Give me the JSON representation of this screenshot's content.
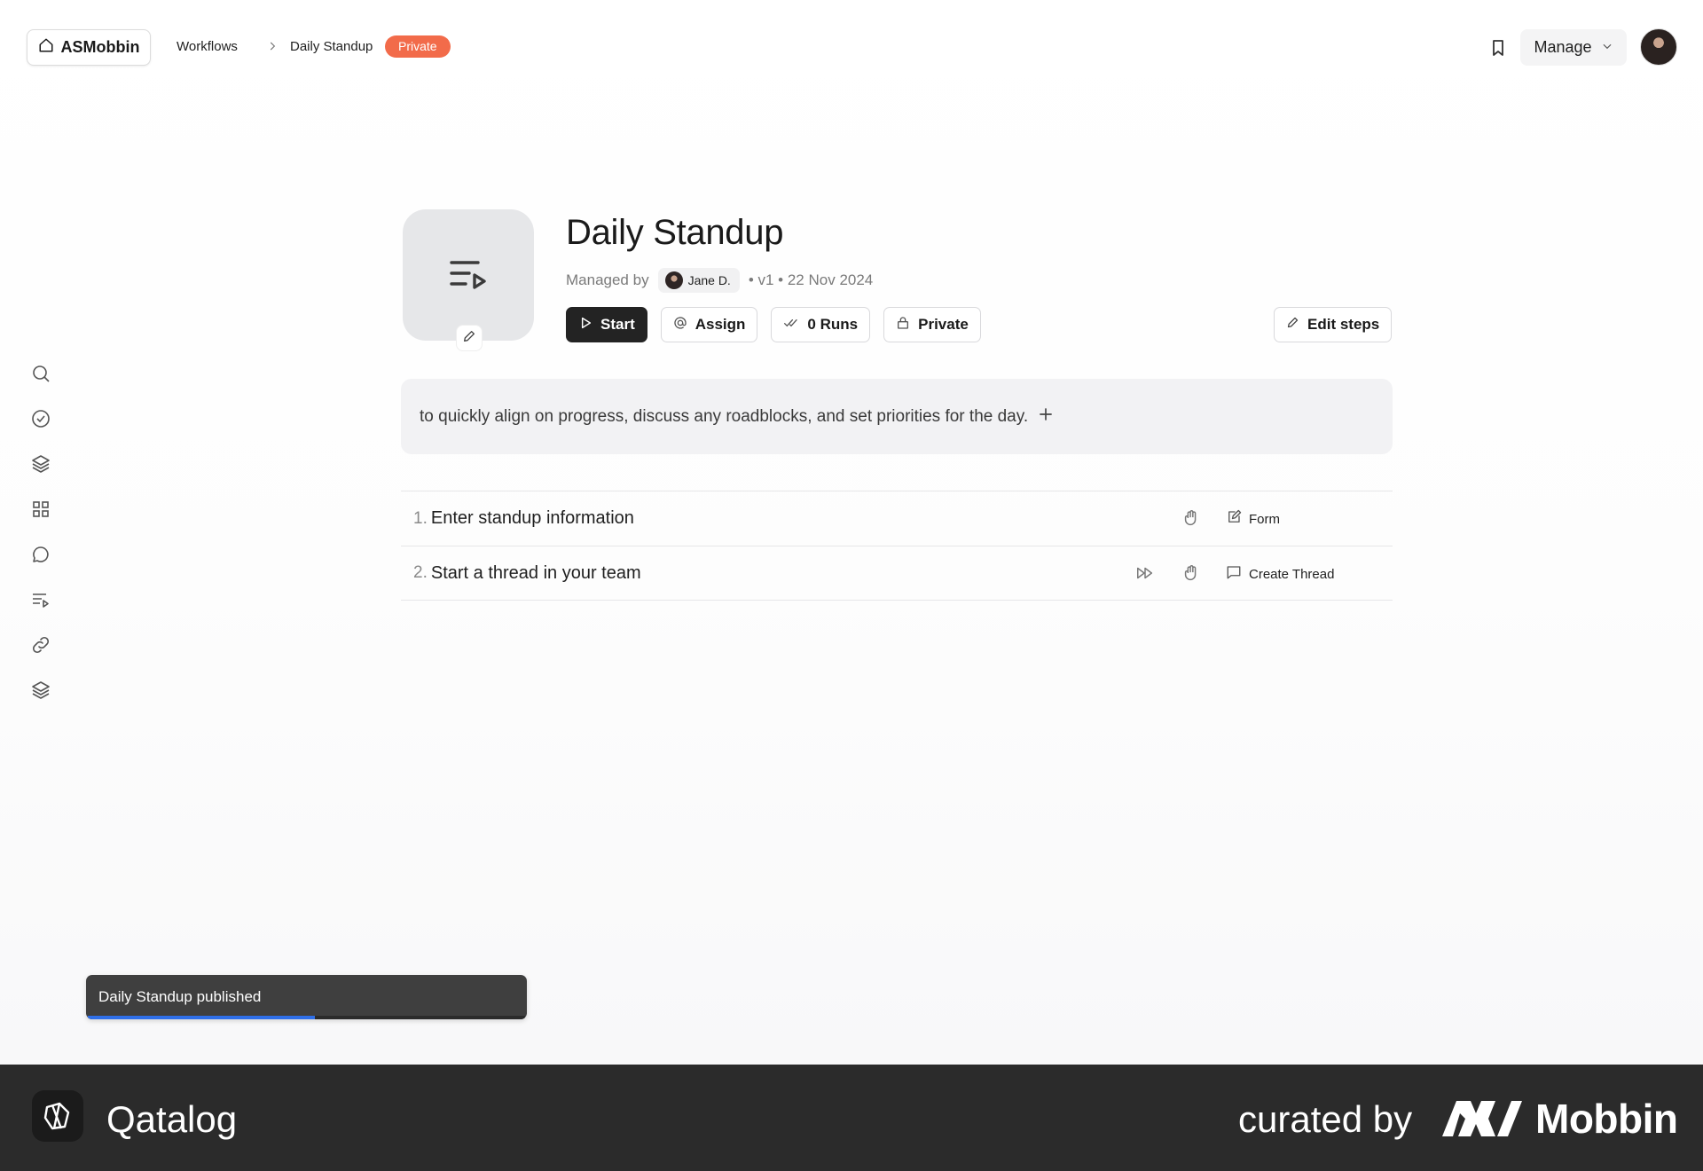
{
  "topbar": {
    "home_label": "ASMobbin",
    "breadcrumb_workflows": "Workflows",
    "breadcrumb_current": "Daily Standup",
    "visibility_badge": "Private",
    "manage_label": "Manage"
  },
  "sidebar": {
    "items": [
      {
        "icon": "search-icon"
      },
      {
        "icon": "check-circle-icon"
      },
      {
        "icon": "layers-icon"
      },
      {
        "icon": "grid-icon"
      },
      {
        "icon": "chat-icon"
      },
      {
        "icon": "workflow-list-icon"
      },
      {
        "icon": "link-icon"
      },
      {
        "icon": "stack-icon"
      }
    ]
  },
  "workflow": {
    "title": "Daily Standup",
    "managed_by_label": "Managed by",
    "manager_name": "Jane D.",
    "version_date": "• v1 • 22 Nov 2024",
    "actions": {
      "start": "Start",
      "assign": "Assign",
      "runs": "0 Runs",
      "private": "Private",
      "edit_steps": "Edit steps"
    },
    "description": "to quickly align on progress, discuss any roadblocks, and set priorities for the day."
  },
  "steps": [
    {
      "number": "1.",
      "title": "Enter standup information",
      "type": "Form"
    },
    {
      "number": "2.",
      "title": "Start a thread in your team",
      "type": "Create Thread"
    }
  ],
  "toast": {
    "message": "Daily Standup published",
    "progress": 0.52
  },
  "footer": {
    "brand": "Qatalog",
    "curated_by": "curated by",
    "curator": "Mobbin"
  },
  "colors": {
    "badge": "#f26b4a",
    "primary_button": "#232323",
    "toast_bg": "#3f3f3f",
    "toast_progress": "#2f6fe8",
    "footer_bg": "#2b2b2b"
  }
}
